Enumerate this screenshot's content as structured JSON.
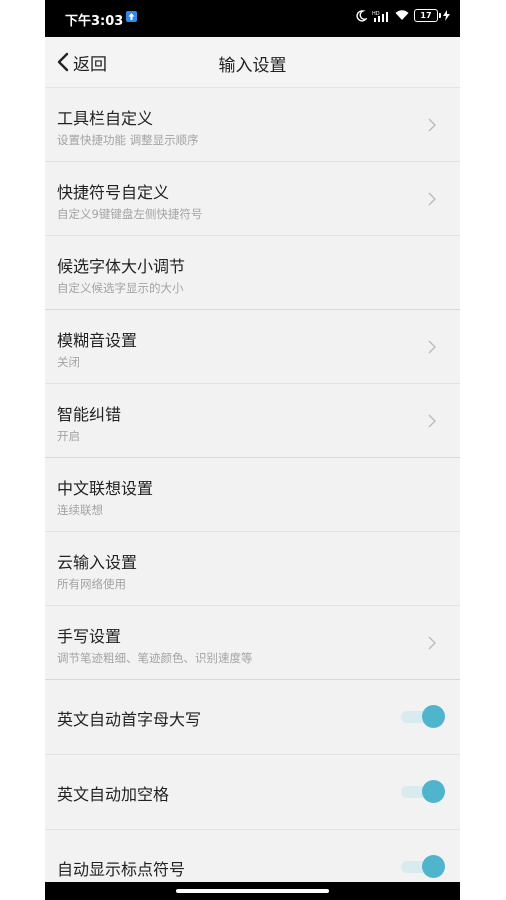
{
  "status_bar": {
    "time": "下午3:03",
    "battery": "17",
    "network": "HD"
  },
  "header": {
    "back_label": "返回",
    "title": "输入设置"
  },
  "items": [
    {
      "title": "工具栏自定义",
      "subtitle": "设置快捷功能 调整显示顺序",
      "control": "chevron"
    },
    {
      "title": "快捷符号自定义",
      "subtitle": "自定义9键键盘左侧快捷符号",
      "control": "chevron"
    },
    {
      "title": "候选字体大小调节",
      "subtitle": "自定义候选字显示的大小",
      "control": "none"
    },
    {
      "title": "模糊音设置",
      "subtitle": "关闭",
      "control": "chevron"
    },
    {
      "title": "智能纠错",
      "subtitle": "开启",
      "control": "chevron"
    },
    {
      "title": "中文联想设置",
      "subtitle": "连续联想",
      "control": "none"
    },
    {
      "title": "云输入设置",
      "subtitle": "所有网络使用",
      "control": "none"
    },
    {
      "title": "手写设置",
      "subtitle": "调节笔迹粗细、笔迹颜色、识别速度等",
      "control": "chevron"
    },
    {
      "title": "英文自动首字母大写",
      "control": "toggle",
      "on": true
    },
    {
      "title": "英文自动加空格",
      "control": "toggle",
      "on": true
    },
    {
      "title": "自动显示标点符号",
      "control": "toggle",
      "on": true
    }
  ],
  "colors": {
    "toggle_on": "#4fb5cc",
    "toggle_track": "#d8ecf0",
    "background": "#f2f2f2"
  }
}
